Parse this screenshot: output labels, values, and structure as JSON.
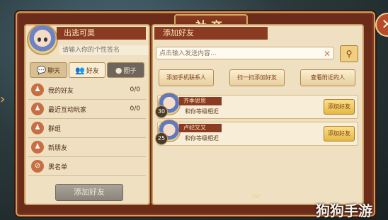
{
  "window": {
    "title": "社交",
    "close_icon": "close-icon"
  },
  "profile": {
    "name": "出逃可昊",
    "signature_placeholder": "请输入你的个性签名"
  },
  "tabs": [
    {
      "label": "聊天",
      "icon": "chat-icon"
    },
    {
      "label": "好友",
      "icon": "friends-icon"
    },
    {
      "label": "圈子",
      "icon": "circle-icon"
    }
  ],
  "menu": [
    {
      "label": "我的好友",
      "count": "0/0",
      "icon": "person-icon"
    },
    {
      "label": "最近互动玩家",
      "count": "0/0",
      "icon": "recent-icon"
    },
    {
      "label": "群组",
      "count": "",
      "icon": "group-icon"
    },
    {
      "label": "新朋友",
      "count": "",
      "icon": "new-friend-icon"
    },
    {
      "label": "黑名单",
      "count": "",
      "icon": "blacklist-icon"
    }
  ],
  "left_footer": {
    "add_friend_label": "添加好友"
  },
  "right": {
    "section_title": "添加好友",
    "search_placeholder": "点击输入发送内容...",
    "actions": [
      "添加手机联系人",
      "扫一扫添加好友",
      "查看附近的人"
    ],
    "friends": [
      {
        "name": "齐季思思",
        "level": "30",
        "desc": "和你等级相近",
        "add_label": "添加好友"
      },
      {
        "name": "卢妃又又",
        "level": "25",
        "desc": "和你等级相近",
        "add_label": "添加好友"
      }
    ]
  },
  "footer": {
    "watermark": "狗狗手游"
  }
}
